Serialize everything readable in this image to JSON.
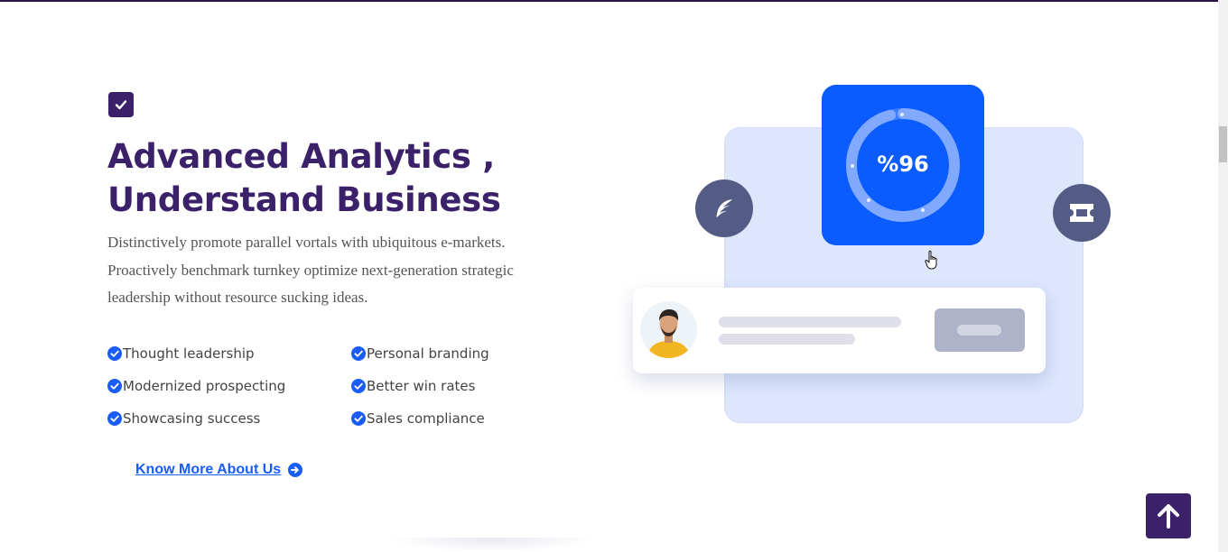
{
  "section": {
    "title_line1": "Advanced Analytics ,",
    "title_line2": "Understand Business",
    "description": "Distinctively promote parallel vortals with ubiquitous e-markets. Proactively benchmark turnkey optimize next-generation strategic leadership without resource sucking ideas.",
    "features": [
      "Thought leadership",
      "Personal branding",
      "Modernized prospecting",
      "Better win rates",
      "Showcasing success",
      "Sales compliance"
    ],
    "link_label": "Know More About Us"
  },
  "illustration": {
    "stat_value": "%96",
    "progress": 0.96,
    "left_icon": "feather-icon",
    "right_icon": "ticket-icon"
  },
  "colors": {
    "brand_purple": "#3b2169",
    "accent_blue": "#0a5cff",
    "link_blue": "#1a5cf7",
    "panel_bg": "#dde6fd",
    "circle_button": "#545c85"
  },
  "icons": {
    "header": "check-square-icon",
    "features": "check-circle-icon",
    "link": "arrow-circle-right-icon",
    "back_to_top": "arrow-up-icon"
  }
}
